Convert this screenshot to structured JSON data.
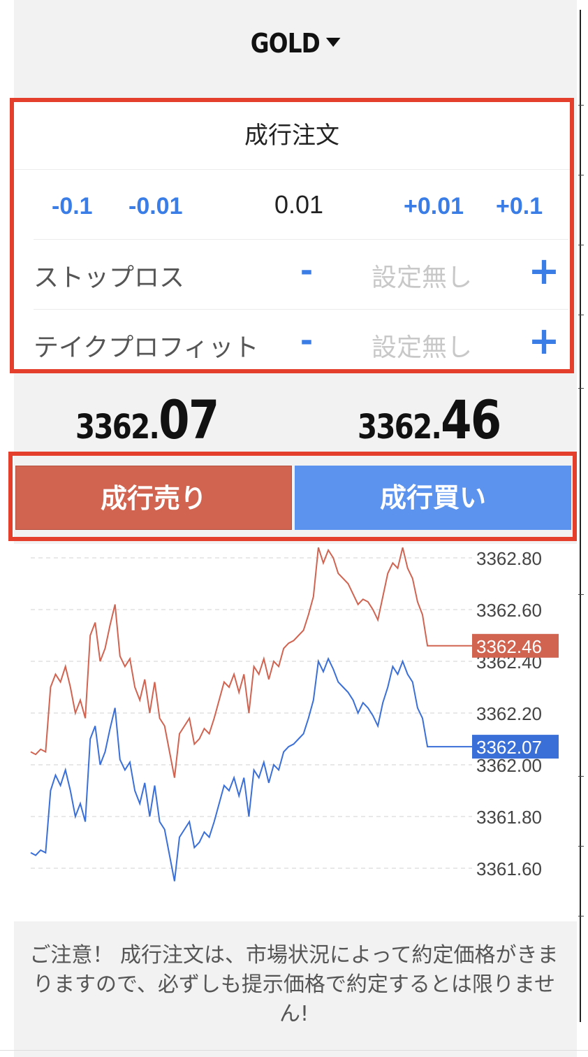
{
  "header": {
    "symbol": "GOLD"
  },
  "order": {
    "title": "成行注文",
    "lot": {
      "dec_large": "-0.1",
      "dec_small": "-0.01",
      "value": "0.01",
      "inc_small": "+0.01",
      "inc_large": "+0.1"
    },
    "stop_loss": {
      "label": "ストップロス",
      "minus": "-",
      "value": "設定無し",
      "plus": "+"
    },
    "take_profit": {
      "label": "テイクプロフィット",
      "minus": "-",
      "value": "設定無し",
      "plus": "+"
    }
  },
  "prices": {
    "bid": {
      "main": "3362.",
      "pips": "07"
    },
    "ask": {
      "main": "3362.",
      "pips": "46"
    }
  },
  "trade": {
    "sell_label": "成行売り",
    "buy_label": "成行買い"
  },
  "colors": {
    "sell": "#d16351",
    "buy": "#5c93ee",
    "accent_blue": "#3a7de6",
    "highlight_border": "#e43f2d"
  },
  "chart_data": {
    "type": "line",
    "y_ticks": [
      "3362.80",
      "3362.60",
      "3362.40",
      "3362.20",
      "3362.00",
      "3361.80",
      "3361.60"
    ],
    "y_tick_values": [
      3362.8,
      3362.6,
      3362.4,
      3362.2,
      3362.0,
      3361.8,
      3361.6
    ],
    "ylim": [
      3361.5,
      3362.85
    ],
    "grid": true,
    "series": [
      {
        "color": "#d16351",
        "current_label": "3362.46",
        "current_value": 3362.46,
        "values": [
          3362.05,
          3362.04,
          3362.06,
          3362.05,
          3362.3,
          3362.35,
          3362.32,
          3362.38,
          3362.3,
          3362.2,
          3362.25,
          3362.18,
          3362.5,
          3362.55,
          3362.4,
          3362.45,
          3362.54,
          3362.62,
          3362.42,
          3362.38,
          3362.41,
          3362.3,
          3362.25,
          3362.33,
          3362.2,
          3362.32,
          3362.18,
          3362.15,
          3362.05,
          3361.95,
          3362.12,
          3362.15,
          3362.18,
          3362.08,
          3362.1,
          3362.14,
          3362.12,
          3362.18,
          3362.25,
          3362.32,
          3362.3,
          3362.35,
          3362.28,
          3362.35,
          3362.2,
          3362.38,
          3362.35,
          3362.41,
          3362.33,
          3362.4,
          3362.38,
          3362.45,
          3362.47,
          3362.48,
          3362.5,
          3362.52,
          3362.58,
          3362.65,
          3362.84,
          3362.78,
          3362.83,
          3362.8,
          3362.74,
          3362.72,
          3362.7,
          3362.66,
          3362.62,
          3362.64,
          3362.63,
          3362.6,
          3362.56,
          3362.65,
          3362.74,
          3362.78,
          3362.76,
          3362.84,
          3362.76,
          3362.72,
          3362.63,
          3362.58,
          3362.46,
          3362.46,
          3362.46,
          3362.46,
          3362.46,
          3362.46,
          3362.46,
          3362.46,
          3362.46,
          3362.46
        ]
      },
      {
        "color": "#3a6fd8",
        "current_label": "3362.07",
        "current_value": 3362.07,
        "values": [
          3361.66,
          3361.65,
          3361.67,
          3361.66,
          3361.9,
          3361.96,
          3361.92,
          3361.98,
          3361.9,
          3361.8,
          3361.85,
          3361.78,
          3362.1,
          3362.15,
          3362.0,
          3362.05,
          3362.14,
          3362.22,
          3362.02,
          3361.98,
          3362.01,
          3361.9,
          3361.85,
          3361.93,
          3361.8,
          3361.92,
          3361.78,
          3361.75,
          3361.65,
          3361.55,
          3361.72,
          3361.75,
          3361.78,
          3361.68,
          3361.7,
          3361.74,
          3361.72,
          3361.78,
          3361.85,
          3361.92,
          3361.9,
          3361.95,
          3361.88,
          3361.95,
          3361.8,
          3361.98,
          3361.95,
          3362.01,
          3361.93,
          3362.0,
          3361.98,
          3362.05,
          3362.07,
          3362.08,
          3362.1,
          3362.12,
          3362.18,
          3362.25,
          3362.4,
          3362.36,
          3362.41,
          3362.37,
          3362.32,
          3362.3,
          3362.28,
          3362.25,
          3362.2,
          3362.24,
          3362.22,
          3362.19,
          3362.15,
          3362.24,
          3362.3,
          3362.38,
          3362.35,
          3362.4,
          3362.35,
          3362.32,
          3362.22,
          3362.18,
          3362.07,
          3362.07,
          3362.07,
          3362.07,
          3362.07,
          3362.07,
          3362.07,
          3362.07,
          3362.07,
          3362.07
        ]
      }
    ]
  },
  "notice": "ご注意！ 成行注文は、市場状況によって約定価格がきまりますので、必ずしも提示価格で約定するとは限りません!"
}
